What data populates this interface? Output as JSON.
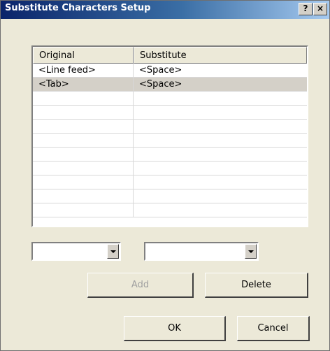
{
  "window": {
    "title": "Substitute Characters Setup",
    "help_label": "?",
    "close_label": "×"
  },
  "table": {
    "columns": [
      "Original",
      "Substitute"
    ],
    "rows": [
      [
        "<Line feed>",
        "<Space>"
      ],
      [
        "<Tab>",
        "<Space>"
      ]
    ],
    "selected_row": 1,
    "empty_rows": 9
  },
  "dropdowns": {
    "original_value": "",
    "substitute_value": ""
  },
  "buttons": {
    "add": "Add",
    "delete": "Delete",
    "ok": "OK",
    "cancel": "Cancel"
  },
  "colors": {
    "title_bar_start": "#0a246a",
    "title_bar_end": "#a6caf0",
    "dialog_face": "#ece9d8",
    "selected_row": "#d4d0c8"
  }
}
